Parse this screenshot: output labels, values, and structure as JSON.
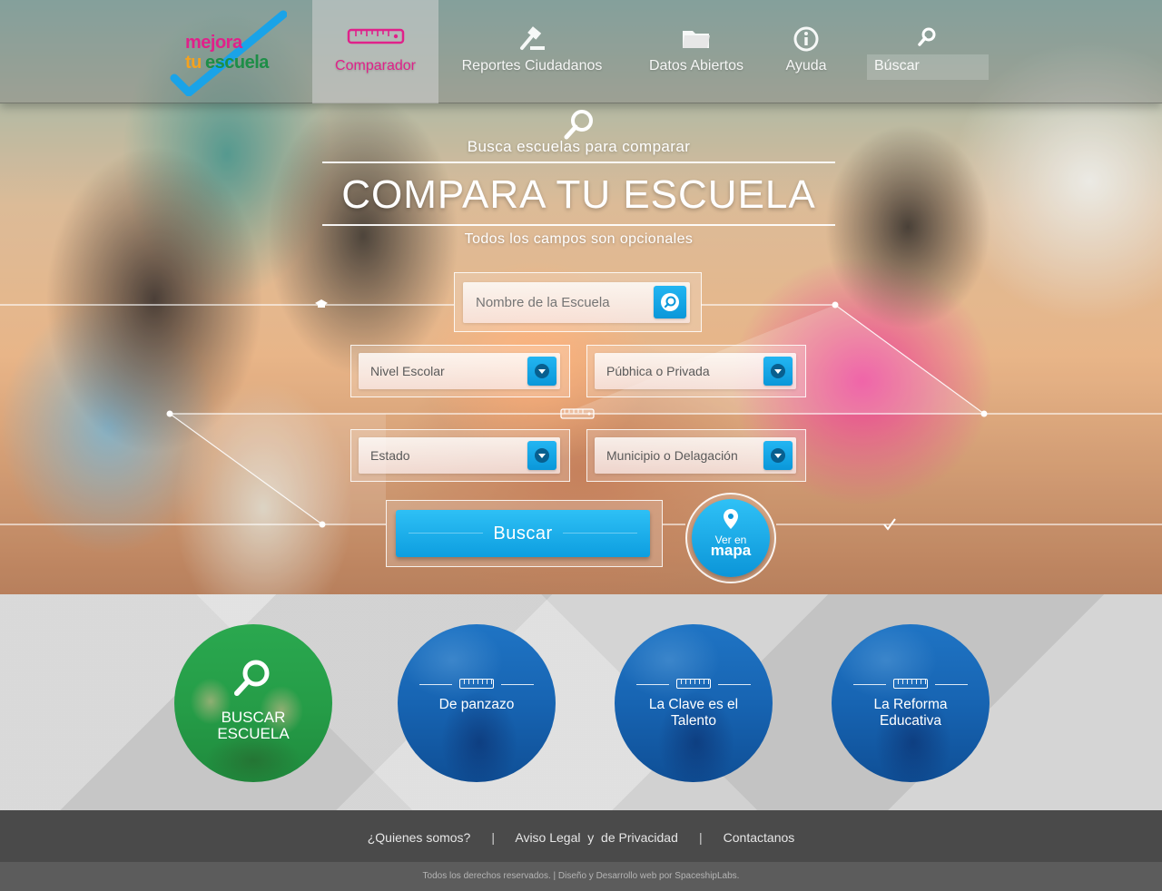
{
  "brand": {
    "logo_line1": "mejora",
    "logo_line2a": "tu",
    "logo_line2b": "escuela"
  },
  "nav": {
    "items": [
      {
        "label": "Comparador",
        "icon": "ruler-icon",
        "active": true
      },
      {
        "label": "Reportes Ciudadanos",
        "icon": "gavel-icon",
        "active": false
      },
      {
        "label": "Datos Abiertos",
        "icon": "folder-icon",
        "active": false
      },
      {
        "label": "Ayuda",
        "icon": "info-icon",
        "active": false
      }
    ],
    "search_label": "Búscar",
    "search_icon": "search-icon"
  },
  "hero": {
    "subtitle": "Busca escuelas para comparar",
    "title": "COMPARA TU ESCUELA",
    "note": "Todos los campos son opcionales"
  },
  "form": {
    "school_name_placeholder": "Nombre de la Escuela",
    "level_label": "Nivel Escolar",
    "type_label": "Púbhica o Privada",
    "state_label": "Estado",
    "municipality_label": "Municipio o Delagación",
    "search_button": "Buscar",
    "map_line1": "Ver en",
    "map_line2": "mapa"
  },
  "features": [
    {
      "label": "BUSCAR ESCUELA",
      "style": "green",
      "icon": "search-icon"
    },
    {
      "label": "De panzazo",
      "style": "blue",
      "icon": "ruler-icon"
    },
    {
      "label": "La Clave es el Talento",
      "style": "blue",
      "icon": "ruler-icon"
    },
    {
      "label": "La Reforma Educativa",
      "style": "blue",
      "icon": "ruler-icon"
    }
  ],
  "footer": {
    "link_about": "¿Quienes somos?",
    "link_legal": "Aviso Legal  y  de Privacidad",
    "link_contact": "Contactanos",
    "separator": "|",
    "copyright": "Todos los derechos reservados. | Diseño y Desarrollo web por SpaceshipLabs."
  },
  "colors": {
    "accent_pink": "#e0218a",
    "accent_blue": "#0d9ee0",
    "logo_orange": "#f4a21f",
    "logo_green": "#1d8e47",
    "circle_blue": "#1764b2",
    "circle_green": "#259c47",
    "footer_dark": "#4a4a4a"
  }
}
